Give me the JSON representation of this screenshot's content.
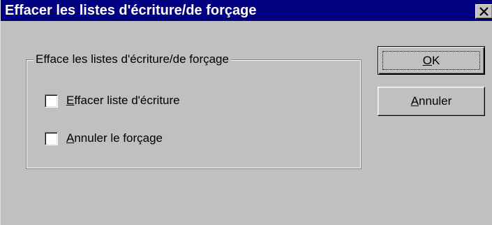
{
  "dialog": {
    "title": "Effacer les listes d'écriture/de forçage",
    "close_icon": "close-icon"
  },
  "group": {
    "label": "Efface les listes d'écriture/de forçage",
    "options": [
      {
        "label_underlined": "E",
        "label_rest": "ffacer liste d'écriture",
        "checked": false
      },
      {
        "label_underlined": "A",
        "label_rest": "nnuler le forçage",
        "checked": false
      }
    ]
  },
  "buttons": {
    "ok": {
      "label_underlined": "O",
      "label_rest": "K"
    },
    "cancel": {
      "label_underlined": "A",
      "label_rest": "nnuler"
    }
  },
  "colors": {
    "titlebar": "#000080",
    "face": "#c0c0c0"
  }
}
